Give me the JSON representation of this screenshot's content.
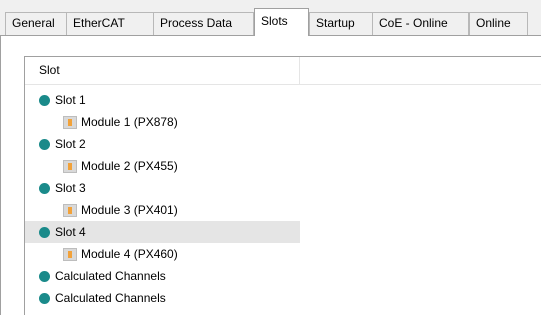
{
  "tabs": [
    {
      "label": "General",
      "active": false
    },
    {
      "label": "EtherCAT",
      "active": false
    },
    {
      "label": "Process Data",
      "active": false
    },
    {
      "label": "Slots",
      "active": true
    },
    {
      "label": "Startup",
      "active": false
    },
    {
      "label": "CoE - Online",
      "active": false
    },
    {
      "label": "Online",
      "active": false
    }
  ],
  "tree": {
    "column_header": "Slot",
    "items": [
      {
        "label": "Slot 1",
        "type": "slot",
        "icon": "teal-circle-icon"
      },
      {
        "label": "Module 1 (PX878)",
        "type": "module",
        "icon": "module-icon"
      },
      {
        "label": "Slot 2",
        "type": "slot",
        "icon": "teal-circle-icon"
      },
      {
        "label": "Module 2 (PX455)",
        "type": "module",
        "icon": "module-icon"
      },
      {
        "label": "Slot 3",
        "type": "slot",
        "icon": "teal-circle-icon"
      },
      {
        "label": "Module 3 (PX401)",
        "type": "module",
        "icon": "module-icon"
      },
      {
        "label": "Slot 4",
        "type": "slot",
        "icon": "teal-circle-icon",
        "selected": true
      },
      {
        "label": "Module 4 (PX460)",
        "type": "module",
        "icon": "module-icon"
      },
      {
        "label": "Calculated Channels",
        "type": "slot",
        "icon": "teal-circle-icon"
      },
      {
        "label": "Calculated Channels",
        "type": "slot",
        "icon": "teal-circle-icon"
      }
    ]
  },
  "colors": {
    "slot_dot": "#1a8a8a",
    "module_accent": "#f2a23a",
    "selection": "#e5e5e5"
  }
}
